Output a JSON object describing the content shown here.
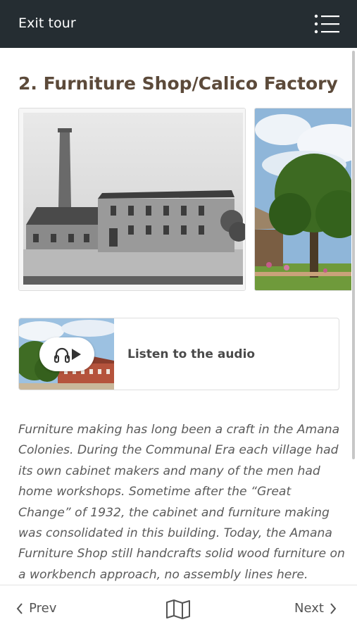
{
  "header": {
    "exit_label": "Exit tour",
    "menu_icon": "menu-list-icon",
    "background": "#252d32"
  },
  "stop": {
    "title": "2. Furniture Shop/Calico Factory",
    "title_color": "#5c4a3a"
  },
  "gallery": {
    "photos": [
      {
        "subject": "historic-factory-photo"
      },
      {
        "subject": "tree-and-building-photo"
      }
    ]
  },
  "audio": {
    "label": "Listen to the audio",
    "icon": "headphones-play-icon"
  },
  "description": {
    "text": "Furniture making has long been a craft in the Amana Colonies. During the Communal Era each village had its own cabinet makers and many of the men had home workshops. Sometime after the “Great Change” of 1932, the cabinet and furniture making was consolidated in this building. Today, the Amana Furniture Shop still handcrafts solid wood furniture on a workbench approach, no assembly lines here."
  },
  "footer": {
    "prev_label": "Prev",
    "next_label": "Next",
    "map_icon": "map-icon"
  }
}
